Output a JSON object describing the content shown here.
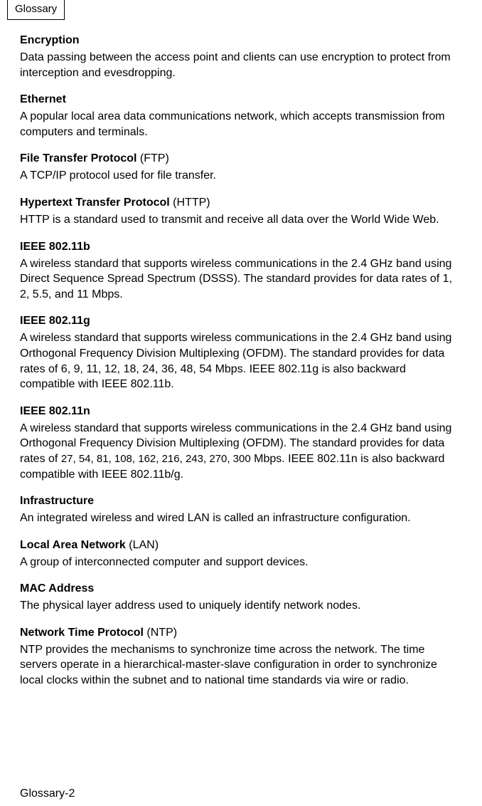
{
  "header": {
    "tab_label": "Glossary"
  },
  "entries": [
    {
      "term": "Encryption",
      "abbr": "",
      "definition": "Data passing between the access point and clients can use encryption to protect from interception and evesdropping."
    },
    {
      "term": "Ethernet",
      "abbr": "",
      "definition": "A popular local area data communications network, which accepts transmission from computers and terminals."
    },
    {
      "term": "File Transfer Protocol",
      "abbr": " (FTP)",
      "definition": "A TCP/IP protocol used for file transfer."
    },
    {
      "term": "Hypertext Transfer Protocol",
      "abbr": " (HTTP)",
      "definition": "HTTP is a standard used to transmit and receive all data over the World Wide Web."
    },
    {
      "term": "IEEE 802.11b",
      "abbr": "",
      "definition": "A wireless standard that supports wireless communications in the 2.4 GHz band using Direct Sequence Spread Spectrum (DSSS). The standard provides for data rates of 1, 2, 5.5, and 11 Mbps."
    },
    {
      "term": "IEEE 802.11g",
      "abbr": "",
      "definition": "A wireless standard that supports wireless communications in the 2.4 GHz band using Orthogonal Frequency Division Multiplexing (OFDM). The standard provides for data rates of 6, 9, 11, 12, 18, 24, 36, 48, 54 Mbps. IEEE 802.11g is also backward compatible with IEEE 802.11b."
    },
    {
      "term": "IEEE 802.11n",
      "abbr": "",
      "def_pre": "A wireless standard that supports wireless communications in the 2.4 GHz band using Orthogonal Frequency Division Multiplexing (OFDM). The standard provides for data rates of ",
      "def_rates": "27, 54, 81, 108, 162, 216, 243, 270, 300",
      "def_post": " Mbps. IEEE 802.11n is also backward compatible with IEEE 802.11b/g."
    },
    {
      "term": "Infrastructure",
      "abbr": "",
      "definition": "An integrated wireless and wired LAN is called an infrastructure configuration."
    },
    {
      "term": "Local Area Network",
      "abbr": " (LAN)",
      "definition": "A group of interconnected computer and support devices."
    },
    {
      "term": "MAC Address",
      "abbr": "",
      "definition": "The physical layer address used to uniquely identify network nodes."
    },
    {
      "term": "Network Time Protocol",
      "abbr": " (NTP)",
      "definition": "NTP provides the mechanisms to synchronize time across the network. The time servers operate in a hierarchical-master-slave configuration in order to synchronize local clocks within the subnet and to national time standards via wire or radio."
    }
  ],
  "footer": {
    "page_label": "Glossary-2"
  }
}
